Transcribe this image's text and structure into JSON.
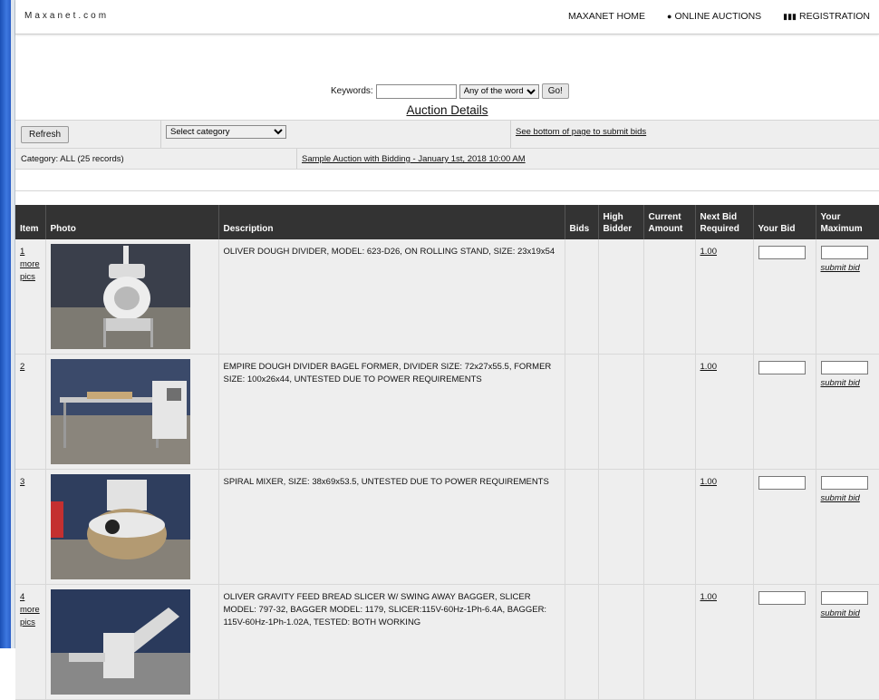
{
  "nav": {
    "brand": "Maxanet.com",
    "home": "MAXANET HOME",
    "auctions": "ONLINE AUCTIONS",
    "registration": "REGISTRATION"
  },
  "search": {
    "keywords_label": "Keywords:",
    "keywords_value": "",
    "match_option": "Any of the words",
    "go_label": "Go!"
  },
  "title": "Auction Details",
  "toolbar": {
    "refresh_label": "Refresh",
    "category_select": "Select category",
    "bottom_link": "See bottom of page to submit bids"
  },
  "info": {
    "category": "Category: ALL (25 records)",
    "auction": "Sample Auction with Bidding - January 1st, 2018 10:00 AM"
  },
  "columns": [
    "Item",
    "Photo",
    "Description",
    "Bids",
    "High Bidder",
    "Current Amount",
    "Next Bid Required",
    "Your Bid",
    "Your Maximum"
  ],
  "more_pics": "more pics",
  "submit_bid": "submit bid",
  "items": [
    {
      "num": "1",
      "more_pics": true,
      "description": "OLIVER DOUGH DIVIDER, MODEL: 623-D26, ON ROLLING STAND, SIZE: 23x19x54",
      "bids": "",
      "high_bidder": "",
      "current_amount": "",
      "next_bid": "1.00"
    },
    {
      "num": "2",
      "more_pics": false,
      "description": "EMPIRE DOUGH DIVIDER BAGEL FORMER, DIVIDER SIZE: 72x27x55.5, FORMER SIZE: 100x26x44, UNTESTED DUE TO POWER REQUIREMENTS",
      "bids": "",
      "high_bidder": "",
      "current_amount": "",
      "next_bid": "1.00"
    },
    {
      "num": "3",
      "more_pics": false,
      "description": "SPIRAL MIXER, SIZE: 38x69x53.5, UNTESTED DUE TO POWER REQUIREMENTS",
      "bids": "",
      "high_bidder": "",
      "current_amount": "",
      "next_bid": "1.00"
    },
    {
      "num": "4",
      "more_pics": true,
      "description": "OLIVER GRAVITY FEED BREAD SLICER W/ SWING AWAY BAGGER, SLICER MODEL: 797-32, BAGGER MODEL: 1179, SLICER:115V-60Hz-1Ph-6.4A, BAGGER: 115V-60Hz-1Ph-1.02A, TESTED: BOTH WORKING",
      "bids": "",
      "high_bidder": "",
      "current_amount": "",
      "next_bid": "1.00"
    }
  ]
}
